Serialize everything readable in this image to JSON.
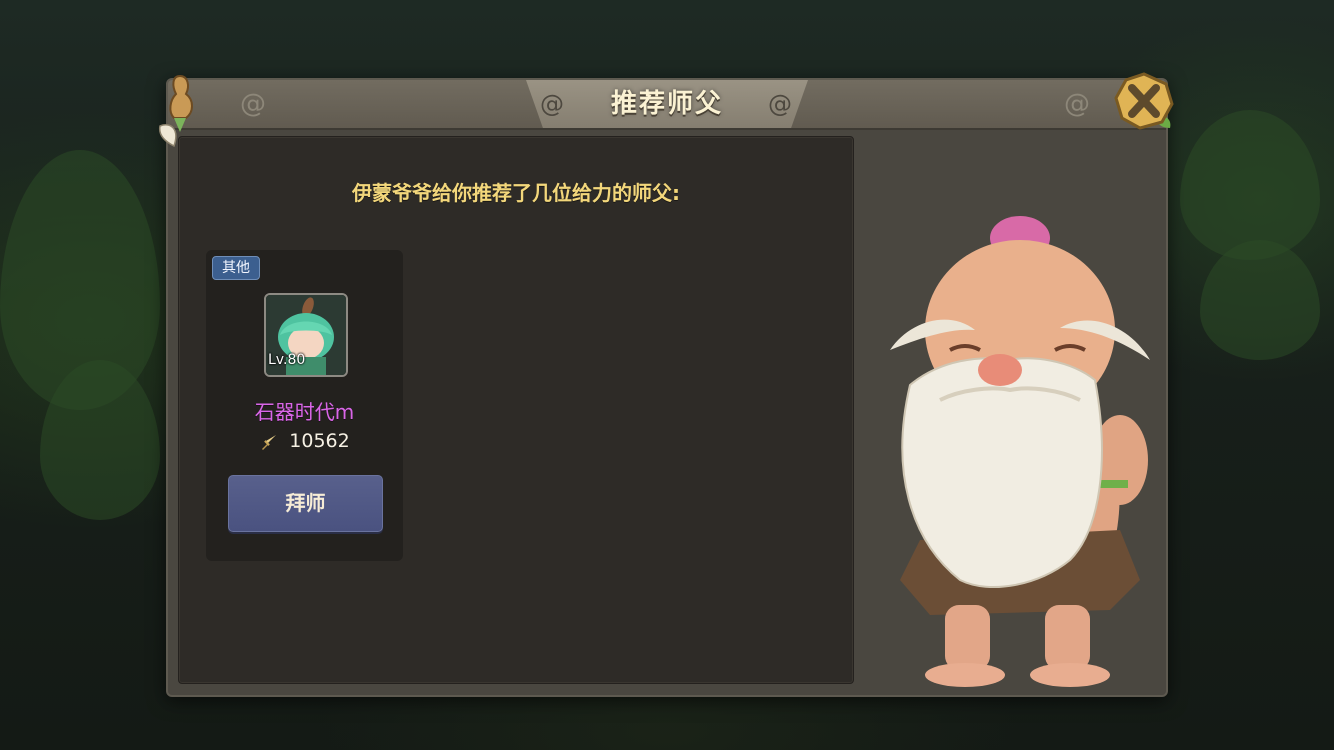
{
  "dialog": {
    "title": "推荐师父",
    "intro_text": "伊蒙爷爷给你推荐了几位给力的师父:"
  },
  "recommendations": [
    {
      "tag": "其他",
      "level": "Lv.80",
      "name": "石器时代m",
      "power": "10562",
      "action_label": "拜师",
      "avatar_icon": "green-haired-character-portrait"
    }
  ],
  "colors": {
    "title_text": "#fbf2d3",
    "intro_text": "#f3d77b",
    "player_name": "#d966e8",
    "tag_background": "#3c5f8f",
    "button_background": "#4a5280"
  },
  "icons": {
    "close": "close-x-icon",
    "power": "sword-power-icon",
    "npc": "old-bearded-master-npc"
  }
}
